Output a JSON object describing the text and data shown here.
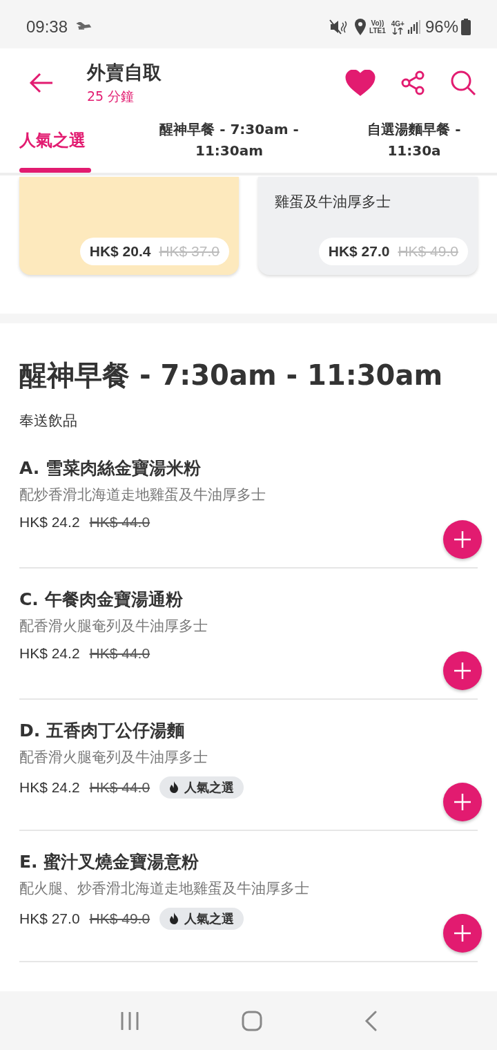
{
  "status_bar": {
    "time": "09:38",
    "volte": "Vo))",
    "lte": "LTE1",
    "network": "4G+",
    "battery": "96%"
  },
  "header": {
    "title": "外賣自取",
    "subtitle": "25 分鐘",
    "favorite": true
  },
  "tabs": [
    {
      "label": "人氣之選",
      "selected": true
    },
    {
      "label": "醒神早餐 - 7:30am - 11:30am",
      "selected": false
    },
    {
      "label": "自選湯麵早餐 - 11:30a",
      "selected": false
    }
  ],
  "featured": [
    {
      "kind": "yellow",
      "price": "HK$ 20.4",
      "old_price": "HK$ 37.0"
    },
    {
      "kind": "grey",
      "description": "雞蛋及牛油厚多士",
      "price": "HK$ 27.0",
      "old_price": "HK$ 49.0"
    }
  ],
  "section": {
    "title": "醒神早餐 - 7:30am - 11:30am",
    "subtitle": "奉送飲品",
    "items": [
      {
        "name": "A. 雪菜肉絲金寶湯米粉",
        "description": "配炒香滑北海道走地雞蛋及牛油厚多士",
        "price": "HK$ 24.2",
        "old_price": "HK$ 44.0"
      },
      {
        "name": "C. 午餐肉金寶湯通粉",
        "description": "配香滑火腿奄列及牛油厚多士",
        "price": "HK$ 24.2",
        "old_price": "HK$ 44.0"
      },
      {
        "name": "D. 五香肉丁公仔湯麵",
        "description": "配香滑火腿奄列及牛油厚多士",
        "price": "HK$ 24.2",
        "old_price": "HK$ 44.0",
        "badge": "人氣之選"
      },
      {
        "name": "E. 蜜汁叉燒金寶湯意粉",
        "description": "配火腿、炒香滑北海道走地雞蛋及牛油厚多士",
        "price": "HK$ 27.0",
        "old_price": "HK$ 49.0",
        "badge": "人氣之選"
      }
    ]
  }
}
